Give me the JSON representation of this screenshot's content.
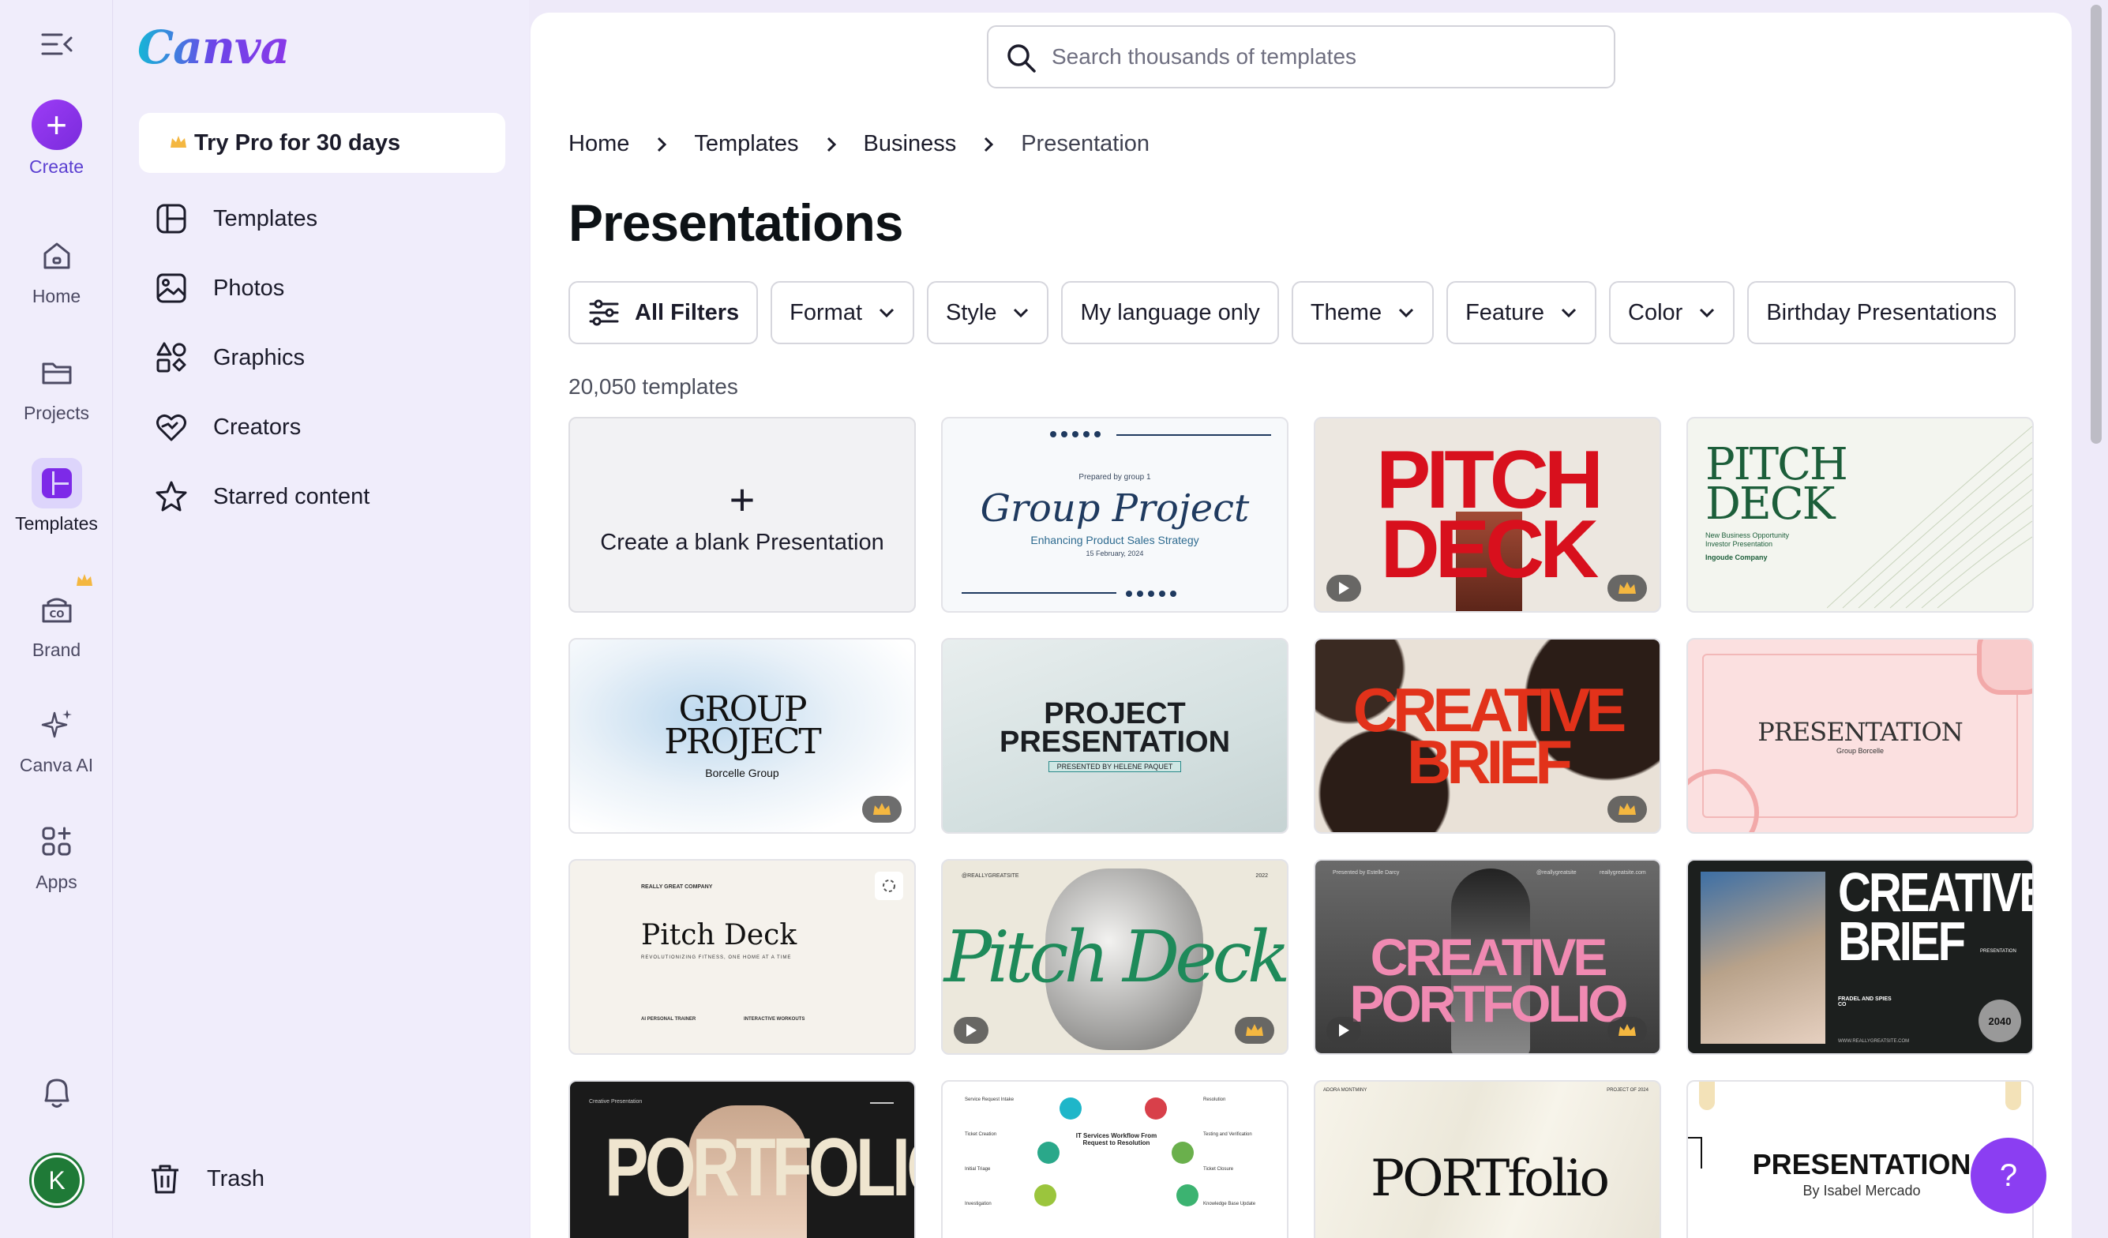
{
  "rail": {
    "create_label": "Create",
    "items": [
      {
        "label": "Home"
      },
      {
        "label": "Projects"
      },
      {
        "label": "Templates"
      },
      {
        "label": "Brand"
      },
      {
        "label": "Canva AI"
      },
      {
        "label": "Apps"
      }
    ],
    "avatar_initial": "K"
  },
  "panel": {
    "logo": "Canva",
    "try_pro": "Try Pro for 30 days",
    "nav": [
      {
        "label": "Templates"
      },
      {
        "label": "Photos"
      },
      {
        "label": "Graphics"
      },
      {
        "label": "Creators"
      },
      {
        "label": "Starred content"
      }
    ],
    "trash": "Trash"
  },
  "main": {
    "search_placeholder": "Search thousands of templates",
    "breadcrumb": [
      "Home",
      "Templates",
      "Business",
      "Presentation"
    ],
    "title": "Presentations",
    "filters": {
      "all": "All Filters",
      "format": "Format",
      "style": "Style",
      "language": "My language only",
      "theme": "Theme",
      "feature": "Feature",
      "color": "Color",
      "birthday": "Birthday Presentations"
    },
    "count": "20,050 templates",
    "blank_card": "Create a blank Presentation",
    "cards": {
      "c1": {
        "top": "Prepared by group 1",
        "title": "Group Project",
        "sub": "Enhancing Product Sales Strategy",
        "date": "15 February, 2024"
      },
      "c2": {
        "line1": "PITCH",
        "line2": "DECK"
      },
      "c3": {
        "line1": "PITCH",
        "line2": "DECK",
        "sub": "New Business Opportunity Investor Presentation",
        "company": "Ingoude Company"
      },
      "c4": {
        "line1": "GROUP",
        "line2": "PROJECT",
        "sub": "Borcelle Group"
      },
      "c5": {
        "line1": "PROJECT",
        "line2": "PRESENTATION",
        "sub": "PRESENTED BY HELENE PAQUET"
      },
      "c6": {
        "line1": "CREATIVE",
        "line2": "BRIEF"
      },
      "c7": {
        "title": "PRESENTATION",
        "sub": "Group Borcelle"
      },
      "c8": {
        "top": "REALLY GREAT COMPANY",
        "title": "Pitch Deck",
        "sub": "REVOLUTIONIZING FITNESS, ONE HOME AT A TIME",
        "col1": "AI PERSONAL TRAINER",
        "col2": "INTERACTIVE WORKOUTS"
      },
      "c9": {
        "title": "Pitch Deck",
        "top_left": "@REALLYGREATSITE",
        "top_right": "2022"
      },
      "c10": {
        "line1": "CREATIVE",
        "line2": "PORTFOLIO",
        "top_left": "Presented by Estelle Darcy",
        "top_mid": "@reallygreatsite",
        "top_right": "reallygreatsite.com"
      },
      "c11": {
        "line1": "CREATIVE",
        "line2": "BRIEF",
        "tag": "PRESENTATION",
        "company": "FRADEL AND SPIES CO",
        "year": "2040",
        "site": "WWW.REALLYGREATSITE.COM"
      },
      "c12": {
        "top": "Creative Presentation",
        "title": "PORTFOLIO"
      },
      "c13": {
        "title": "IT Services Workflow From Request to Resolution",
        "l1": "Service Request Intake",
        "l2": "Ticket Creation",
        "l3": "Initial Triage",
        "l4": "Investigation",
        "r1": "Resolution",
        "r2": "Testing and Verification",
        "r3": "Ticket Closure",
        "r4": "Knowledge Base Update"
      },
      "c14": {
        "title": "PORTfolio",
        "top_left": "ADORA MONTMINY",
        "top_right": "PROJECT OF 2024"
      },
      "c15": {
        "title": "PRESENTATION",
        "sub": "By Isabel Mercado"
      }
    }
  },
  "help_label": "?",
  "colors": {
    "accent": "#8b3ef2",
    "rail_bg": "#f0edfb",
    "active_bg": "#ddd5fb",
    "pitch_red": "#d8101d",
    "crown": "#f4b740"
  }
}
